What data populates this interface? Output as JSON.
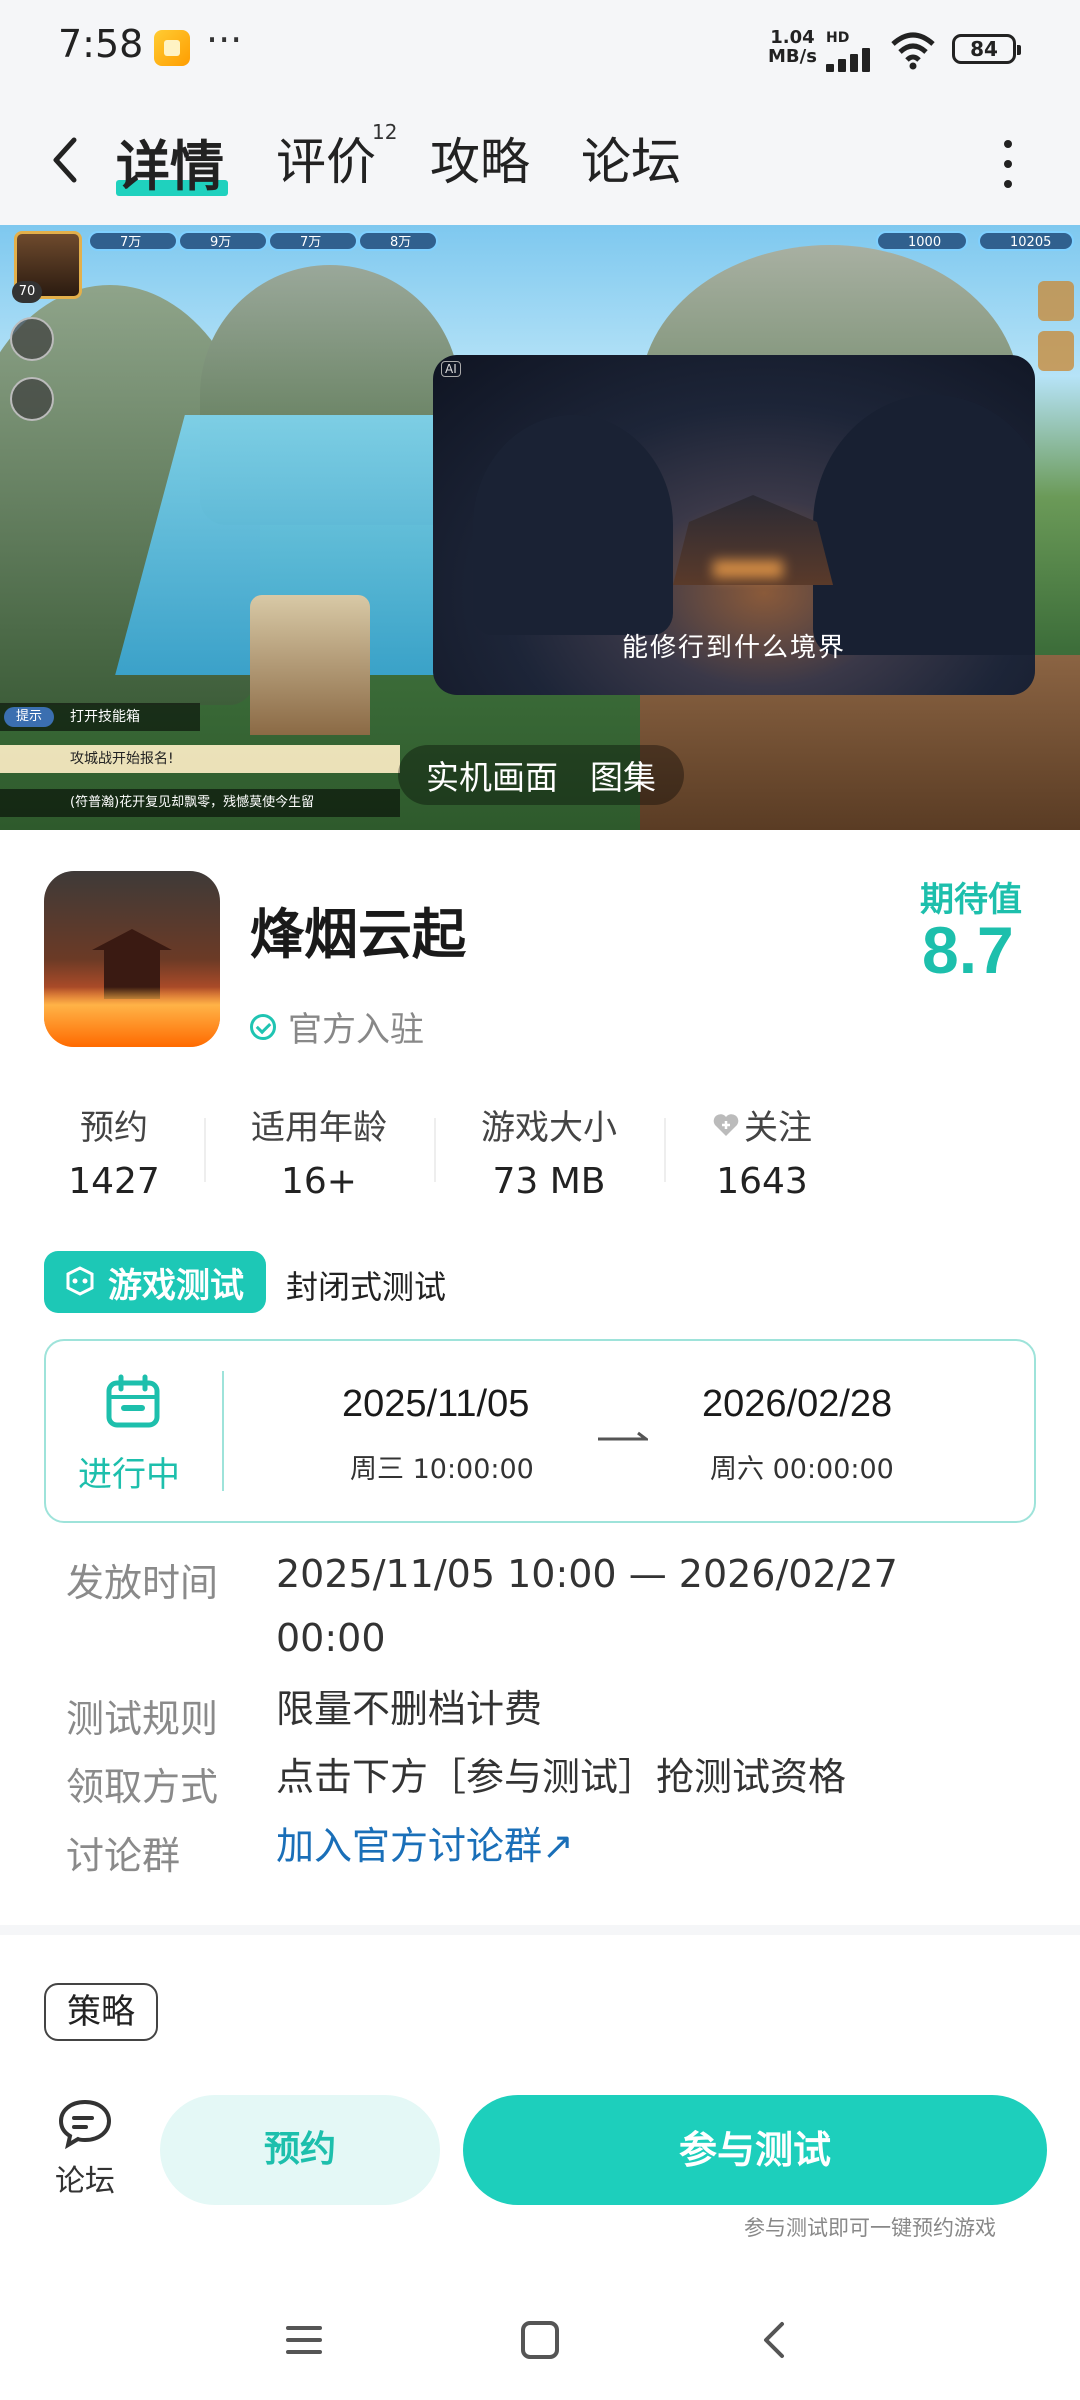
{
  "status_bar": {
    "time": "7:58",
    "more": "···",
    "net_speed_value": "1.04",
    "net_speed_unit": "MB/s",
    "network_type": "HD",
    "battery": "84"
  },
  "header": {
    "tabs": [
      {
        "label": "详情",
        "active": true
      },
      {
        "label": "评价",
        "badge": "12"
      },
      {
        "label": "攻略"
      },
      {
        "label": "论坛"
      }
    ]
  },
  "hero": {
    "hud": {
      "level": "70",
      "bars": [
        "7万",
        "9万",
        "7万",
        "8万"
      ],
      "gold": "1000",
      "silver": "10205",
      "hint_tag": "提示",
      "hint_text": "打开技能箱",
      "notice": "攻城战开始报名!",
      "chat": "(符普瀚)花开复见却飘零，残憾莫使今生留"
    },
    "video_ai_tag": "AI",
    "video_caption": "能修行到什么境界",
    "tabs": [
      "实机画面",
      "图集"
    ]
  },
  "game": {
    "title": "烽烟云起",
    "official_label": "官方入驻",
    "expect_label": "期待值",
    "expect_value": "8.7"
  },
  "stats": [
    {
      "label": "预约",
      "value": "1427"
    },
    {
      "label": "适用年龄",
      "value": "16+"
    },
    {
      "label": "游戏大小",
      "value": "73 MB"
    },
    {
      "label": "关注",
      "value": "1643"
    }
  ],
  "test": {
    "badge": "游戏测试",
    "type": "封闭式测试",
    "status": "进行中",
    "start_date": "2025/11/05",
    "start_time": "周三  10:00:00",
    "end_date": "2026/02/28",
    "end_time": "周六  00:00:00"
  },
  "info": {
    "release_label": "发放时间",
    "release_value": "2025/11/05 10:00 — 2026/02/27 00:00",
    "rules_label": "测试规则",
    "rules_value": "限量不删档计费",
    "method_label": "领取方式",
    "method_value": "点击下方［参与测试］抢测试资格",
    "group_label": "讨论群",
    "group_value": "加入官方讨论群↗"
  },
  "tags": [
    "策略"
  ],
  "actions": {
    "forum_label": "论坛",
    "reserve_label": "预约",
    "join_label": "参与测试",
    "join_hint": "参与测试即可一键预约游戏"
  },
  "colors": {
    "accent": "#1dcfbc",
    "accent_text": "#1dbfac",
    "link": "#1a6fb8"
  }
}
